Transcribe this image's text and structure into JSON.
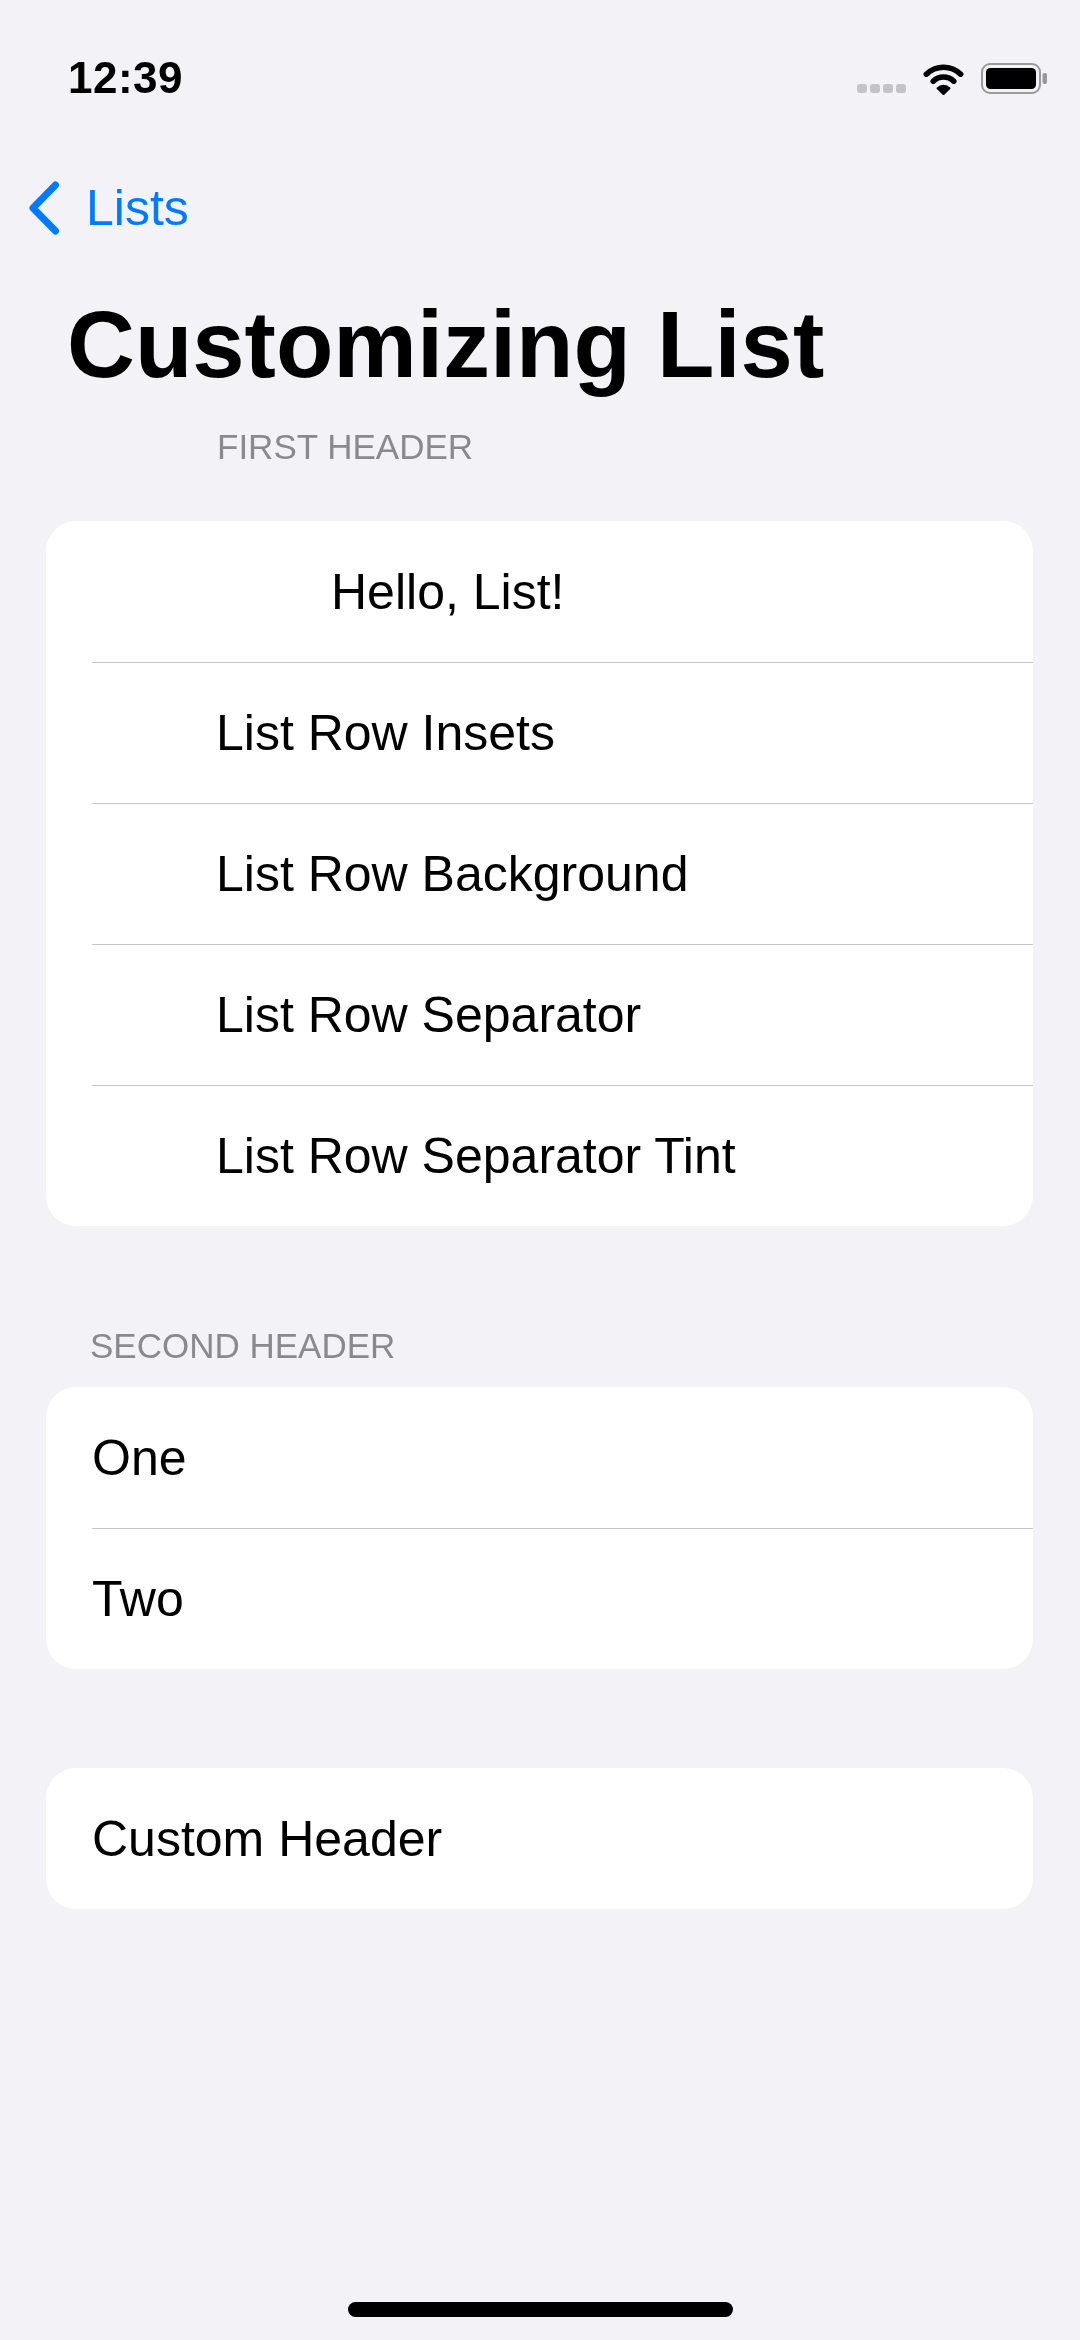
{
  "status_bar": {
    "time": "12:39"
  },
  "navigation": {
    "back_label": "Lists",
    "title": "Customizing List"
  },
  "sections": [
    {
      "kind": "inset",
      "header": "FIRST HEADER",
      "rows": [
        {
          "kind": "deep",
          "label": "Hello, List!"
        },
        {
          "kind": "inset",
          "label": "List Row Insets"
        },
        {
          "kind": "inset",
          "label": "List Row Background"
        },
        {
          "kind": "inset",
          "label": "List Row Separator"
        },
        {
          "kind": "inset",
          "label": "List Row Separator Tint"
        }
      ]
    },
    {
      "kind": "plain",
      "header": "SECOND HEADER",
      "rows": [
        {
          "kind": "plain",
          "label": "One"
        },
        {
          "kind": "plain",
          "label": "Two"
        }
      ]
    },
    {
      "kind": "plain",
      "rows": [
        {
          "kind": "plain",
          "label": "Custom Header"
        }
      ]
    }
  ]
}
